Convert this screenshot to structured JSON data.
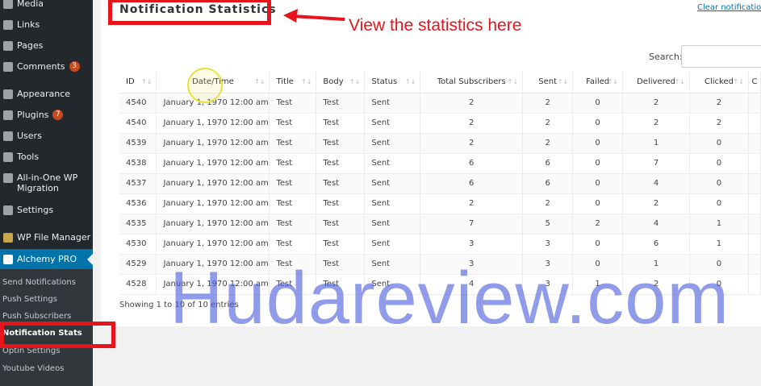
{
  "sidebar": {
    "items": [
      {
        "label": "Media",
        "icon": "media-icon"
      },
      {
        "label": "Links",
        "icon": "links-icon"
      },
      {
        "label": "Pages",
        "icon": "pages-icon"
      },
      {
        "label": "Comments",
        "icon": "comments-icon",
        "badge": "3"
      },
      {
        "label": "Appearance",
        "icon": "appearance-icon"
      },
      {
        "label": "Plugins",
        "icon": "plugins-icon",
        "badge": "7"
      },
      {
        "label": "Users",
        "icon": "users-icon"
      },
      {
        "label": "Tools",
        "icon": "tools-icon"
      },
      {
        "label": "All-in-One WP Migration",
        "icon": "migration-icon"
      },
      {
        "label": "Settings",
        "icon": "settings-icon"
      },
      {
        "label": "WP File Manager",
        "icon": "folder-icon"
      },
      {
        "label": "Alchemy PRO",
        "icon": "alchemy-icon"
      }
    ],
    "submenu": [
      "Send Notifications",
      "Push Settings",
      "Push Subscribers",
      "Notification Stats",
      "Optin Settings",
      "Youtube Videos"
    ]
  },
  "page": {
    "title": "Notification Statistics",
    "annotation": "View the statistics here",
    "clear_link": "Clear notificatio",
    "search_label": "Search:",
    "footer_info": "Showing 1 to 10 of 10 entries",
    "watermark": "Hudareview.com"
  },
  "table": {
    "headers": [
      "ID",
      "Date/Time",
      "Title",
      "Body",
      "Status",
      "Total Subscribers",
      "Sent",
      "Failed",
      "Delivered",
      "Clicked",
      "C"
    ],
    "rows": [
      [
        "4540",
        "January 1, 1970 12:00 am",
        "Test",
        "Test",
        "Sent",
        "2",
        "2",
        "0",
        "2",
        "2"
      ],
      [
        "4540",
        "January 1, 1970 12:00 am",
        "Test",
        "Test",
        "Sent",
        "2",
        "2",
        "0",
        "2",
        "2"
      ],
      [
        "4539",
        "January 1, 1970 12:00 am",
        "Test",
        "Test",
        "Sent",
        "2",
        "2",
        "0",
        "1",
        "0"
      ],
      [
        "4538",
        "January 1, 1970 12:00 am",
        "Test",
        "Test",
        "Sent",
        "6",
        "6",
        "0",
        "7",
        "0"
      ],
      [
        "4537",
        "January 1, 1970 12:00 am",
        "Test",
        "Test",
        "Sent",
        "6",
        "6",
        "0",
        "4",
        "0"
      ],
      [
        "4536",
        "January 1, 1970 12:00 am",
        "Test",
        "Test",
        "Sent",
        "2",
        "2",
        "0",
        "2",
        "0"
      ],
      [
        "4535",
        "January 1, 1970 12:00 am",
        "Test",
        "Test",
        "Sent",
        "7",
        "5",
        "2",
        "4",
        "1"
      ],
      [
        "4530",
        "January 1, 1970 12:00 am",
        "Test",
        "Test",
        "Sent",
        "3",
        "3",
        "0",
        "6",
        "1"
      ],
      [
        "4529",
        "January 1, 1970 12:00 am",
        "Test",
        "Test",
        "Sent",
        "3",
        "3",
        "0",
        "1",
        "0"
      ],
      [
        "4528",
        "January 1, 1970 12:00 am",
        "Test",
        "Test",
        "Sent",
        "4",
        "3",
        "1",
        "2",
        "0"
      ]
    ]
  },
  "colors": {
    "sidebar_bg": "#23282d",
    "active_bg": "#0073aa",
    "highlight": "#e8141c",
    "watermark": "#465ADC"
  }
}
